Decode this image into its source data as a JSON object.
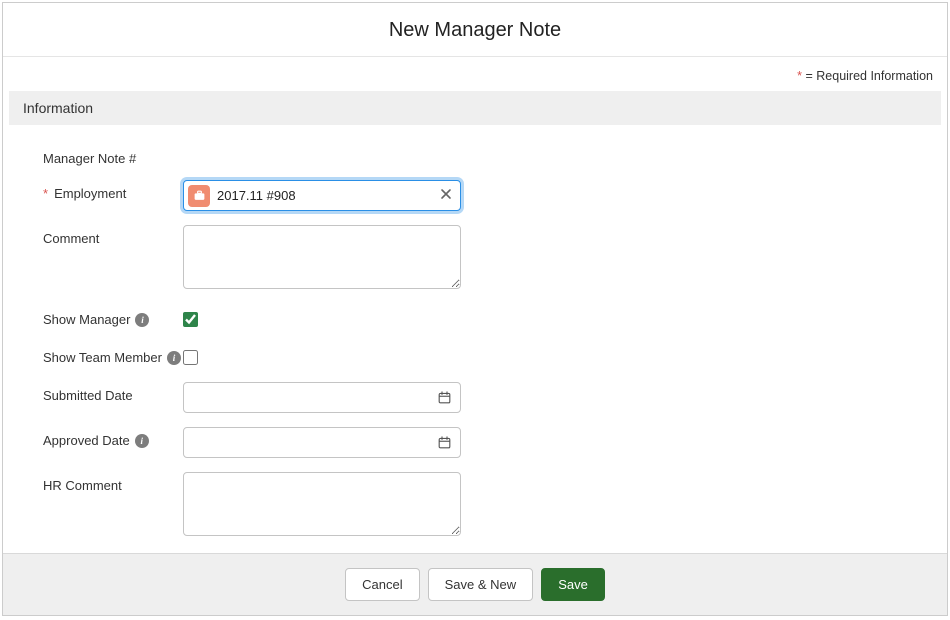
{
  "header": {
    "title": "New Manager Note"
  },
  "requiredNote": {
    "star": "*",
    "text": " = Required Information"
  },
  "section": {
    "title": "Information"
  },
  "fields": {
    "managerNoteNum": {
      "label": "Manager Note #",
      "value": ""
    },
    "employment": {
      "label": "Employment",
      "required": true,
      "value": "2017.11 #908"
    },
    "comment": {
      "label": "Comment",
      "value": ""
    },
    "showManager": {
      "label": "Show Manager",
      "checked": true
    },
    "showTeamMember": {
      "label": "Show Team Member",
      "checked": false
    },
    "submittedDate": {
      "label": "Submitted Date",
      "value": ""
    },
    "approvedDate": {
      "label": "Approved Date",
      "value": ""
    },
    "hrComment": {
      "label": "HR Comment",
      "value": ""
    }
  },
  "buttons": {
    "cancel": "Cancel",
    "saveNew": "Save & New",
    "save": "Save"
  }
}
